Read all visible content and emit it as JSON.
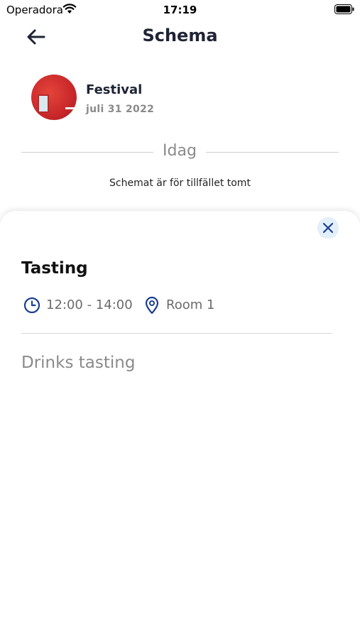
{
  "status_bar": {
    "carrier": "Operadora",
    "time": "17:19"
  },
  "nav": {
    "title": "Schema"
  },
  "event": {
    "name": "Festival",
    "date": "juli 31 2022"
  },
  "section": {
    "label": "Idag"
  },
  "empty_state": "Schemat är för tillfället tomt",
  "sheet": {
    "title": "Tasting",
    "time": "12:00 - 14:00",
    "location": "Room 1",
    "description": "Drinks tasting"
  },
  "colors": {
    "accent": "#1b3f91",
    "title_text": "#1f2334",
    "close_bg": "#e3effa"
  }
}
